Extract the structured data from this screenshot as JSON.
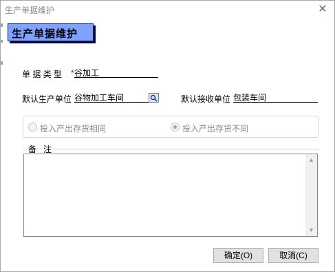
{
  "window": {
    "title": "生产单据维护",
    "close_glyph": "✕"
  },
  "header": {
    "label": "生产单据维护"
  },
  "form": {
    "doc_type_label": "单 据 类 型",
    "required_mark": "*",
    "doc_type_value": "谷加工",
    "default_prod_unit_label": "默认生产单位",
    "default_prod_unit_value": "谷物加工车间",
    "default_recv_unit_label": "默认接收单位",
    "default_recv_unit_value": "包装车间"
  },
  "radios": {
    "same_label": "投入产出存货相同",
    "diff_label": "投入产出存货不同",
    "selected": "diff"
  },
  "notes": {
    "label": "备   注",
    "value": ""
  },
  "buttons": {
    "ok": "确定(O)",
    "cancel": "取消(C)"
  },
  "icons": {
    "search": "search-icon",
    "close": "close-icon"
  },
  "colors": {
    "header_bg": "#7fa2ff",
    "required": "#e00000"
  }
}
